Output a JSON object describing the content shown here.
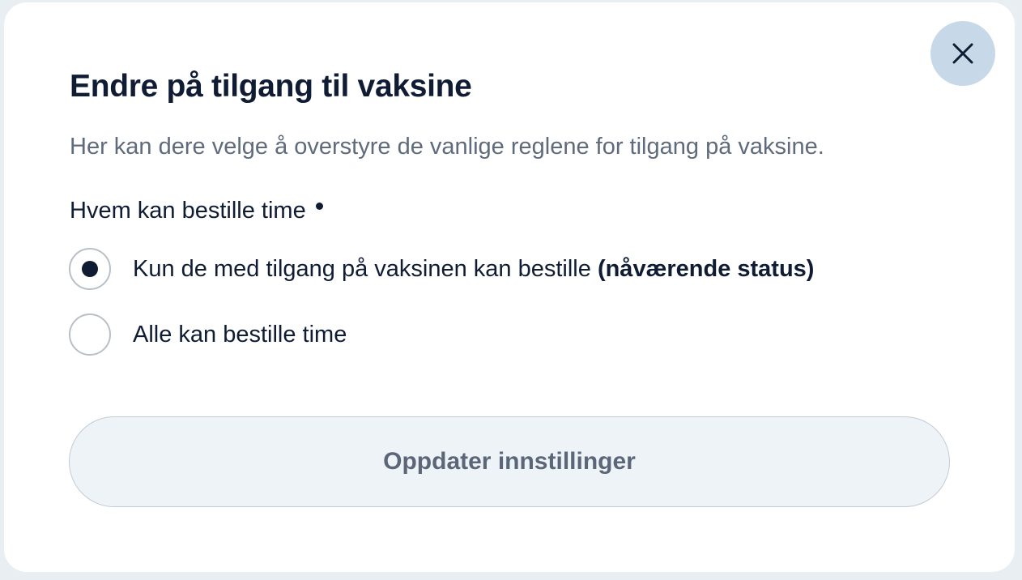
{
  "dialog": {
    "title": "Endre på tilgang til vaksine",
    "description": "Her kan dere velge å overstyre de vanlige reglene for tilgang på vaksine.",
    "close_icon": "close-icon",
    "field": {
      "label": "Hvem kan bestille time",
      "required": true
    },
    "options": [
      {
        "label": "Kun de med tilgang på vaksinen kan bestille",
        "suffix": "(nåværende status)",
        "selected": true
      },
      {
        "label": "Alle kan bestille time",
        "selected": false
      }
    ],
    "submit_label": "Oppdater innstillinger"
  },
  "colors": {
    "text_primary": "#0f1c33",
    "text_secondary": "#5f6b7c",
    "close_button_bg": "#c7d9e8",
    "submit_bg": "#eef3f8",
    "submit_text": "#5b6678"
  }
}
